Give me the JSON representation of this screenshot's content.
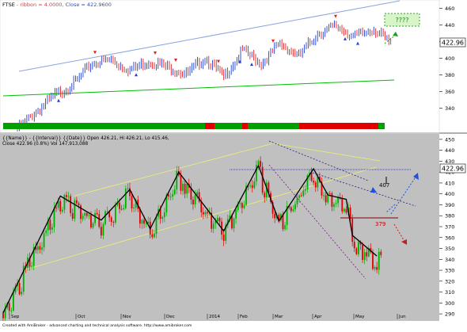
{
  "top_panel": {
    "symbol": "FTSE",
    "indicator": "- ribbon",
    "ribbon_value": "= 4.0000",
    "close_text": "Close = 422.9600",
    "y_ticks": [
      "460",
      "440",
      "420",
      "400",
      "380",
      "360",
      "340"
    ],
    "y_values": [
      460,
      440,
      420,
      400,
      380,
      360,
      340
    ],
    "price_label": "422.96",
    "target_box": "????"
  },
  "bottom_panel": {
    "header_line1": "{{Name}} - {{Interval}} {{Date}} Open 426.21, Hi 426.21, Lo 415.46,",
    "header_line2": "Close 422.96 (0.8%) Vol 147,913,088",
    "y_ticks": [
      "450",
      "440",
      "430",
      "420",
      "410",
      "400",
      "390",
      "380",
      "370",
      "360",
      "350",
      "340",
      "330",
      "320",
      "310",
      "300",
      "290"
    ],
    "y_values": [
      450,
      440,
      430,
      420,
      410,
      400,
      390,
      380,
      370,
      360,
      350,
      340,
      330,
      320,
      310,
      300,
      290
    ],
    "x_labels": [
      "Sep",
      "Oct",
      "Nov",
      "Dec",
      "2014",
      "Feb",
      "Mar",
      "Apr",
      "May",
      "Jun"
    ],
    "price_label": "422.96",
    "level_upper": "407",
    "level_lower": "379"
  },
  "footer": "Created with AmiBroker - advanced charting and technical analysis software. http://www.amibroker.com",
  "colors": {
    "up": "#00a000",
    "down": "#e00000",
    "trend_upper": "#8aa6e0",
    "trend_lower": "#00c000",
    "bottom_bg": "#c0c0c0",
    "zigzag": "#000000",
    "target_box": "#d8f5c8"
  },
  "chart_data": [
    {
      "type": "line",
      "title": "FTSE - ribbon = 4.0000, Close = 422.9600",
      "series": [
        {
          "name": "Close",
          "x": [
            0,
            10,
            20,
            30,
            40,
            50,
            60,
            70,
            80,
            90,
            100,
            110,
            120,
            130,
            140,
            150,
            160,
            170,
            180,
            190,
            199
          ],
          "values": [
            318,
            338,
            358,
            372,
            397,
            400,
            388,
            399,
            392,
            383,
            403,
            380,
            412,
            396,
            420,
            405,
            432,
            441,
            428,
            438,
            420
          ]
        }
      ],
      "ribbon_segments": [
        "green",
        "green",
        "green",
        "red",
        "green",
        "green",
        "green",
        "red",
        "green"
      ],
      "ylim": [
        310,
        470
      ]
    },
    {
      "type": "bar",
      "title": "{{Name}} - {{Interval}} {{Date}}",
      "ohlc_summary": {
        "open": 426.21,
        "high": 426.21,
        "low": 415.46,
        "close": 422.96,
        "change_pct": 0.8,
        "volume": 147913088
      },
      "zigzag": {
        "x": [
          0,
          28,
          48,
          62,
          72,
          86,
          108,
          125,
          135,
          152,
          159,
          168,
          171,
          183
        ],
        "values": [
          291,
          398,
          376,
          404,
          368,
          420,
          366,
          426,
          375,
          423,
          399,
          395,
          362,
          343
        ]
      },
      "levels": [
        407,
        379
      ],
      "ylim": [
        285,
        455
      ]
    }
  ]
}
